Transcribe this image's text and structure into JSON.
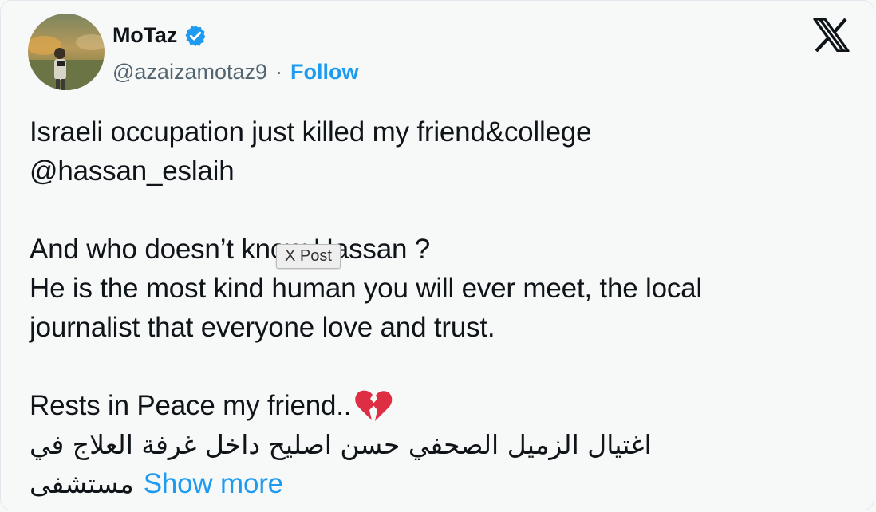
{
  "author": {
    "name": "MoTaz",
    "handle": "@azaizamotaz9",
    "separator": "·",
    "follow_label": "Follow"
  },
  "post": {
    "line1": "Israeli occupation just killed my friend&college",
    "line2": "@hassan_eslaih",
    "line3": "And who doesn’t know Hassan ?",
    "line4": "He is the most kind human you will ever meet, the local",
    "line5": "journalist that everyone love and trust.",
    "line6": "Rests in Peace my friend..",
    "arabic_line1": "اغتيال الزميل الصحفي حسن اصليح داخل غرفة العلاج في",
    "arabic_line2": "مستشفى",
    "show_more": "Show more"
  },
  "tooltip": "X Post",
  "colors": {
    "link": "#1d9bf0",
    "verified": "#1d9bf0",
    "text": "#0f1419",
    "secondary": "#536471"
  }
}
